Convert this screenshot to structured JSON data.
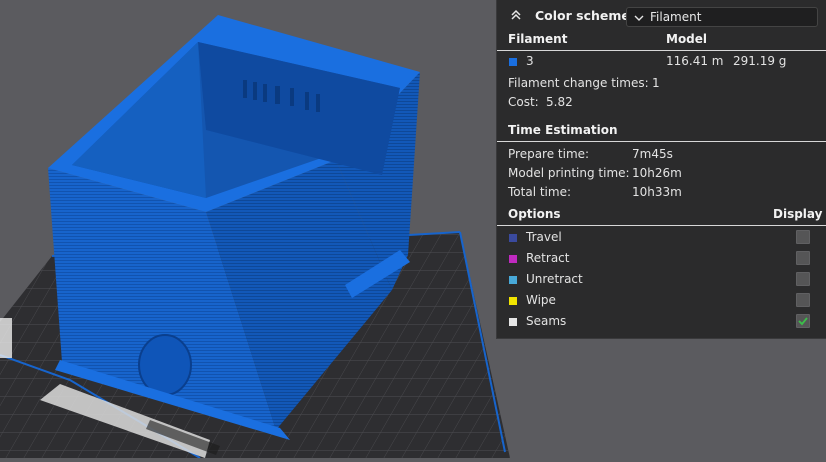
{
  "color_scheme": {
    "title": "Color scheme",
    "selected": "Filament"
  },
  "filament_table": {
    "headers": {
      "filament": "Filament",
      "model": "Model"
    },
    "rows": [
      {
        "id": "3",
        "length": "116.41 m",
        "weight": "291.19 g",
        "color": "#1a6fe0"
      }
    ],
    "change_times_label": "Filament change times:",
    "change_times_value": "1",
    "cost_label": "Cost:",
    "cost_value": "5.82"
  },
  "time_estimation": {
    "title": "Time Estimation",
    "rows": [
      {
        "label": "Prepare time:",
        "value": "7m45s"
      },
      {
        "label": "Model printing time:",
        "value": "10h26m"
      },
      {
        "label": "Total time:",
        "value": "10h33m"
      }
    ]
  },
  "options": {
    "title": "Options",
    "display_label": "Display",
    "items": [
      {
        "label": "Travel",
        "color": "#3a4a9e",
        "checked": false
      },
      {
        "label": "Retract",
        "color": "#c02ac0",
        "checked": false
      },
      {
        "label": "Unretract",
        "color": "#48a9d8",
        "checked": false
      },
      {
        "label": "Wipe",
        "color": "#f1e400",
        "checked": false
      },
      {
        "label": "Seams",
        "color": "#e6e6e6",
        "checked": true
      }
    ]
  },
  "colors": {
    "background": "#5b5b5f",
    "panel": "#2b2b2c",
    "model": "#1764cc",
    "bed": "#2e2e31"
  }
}
